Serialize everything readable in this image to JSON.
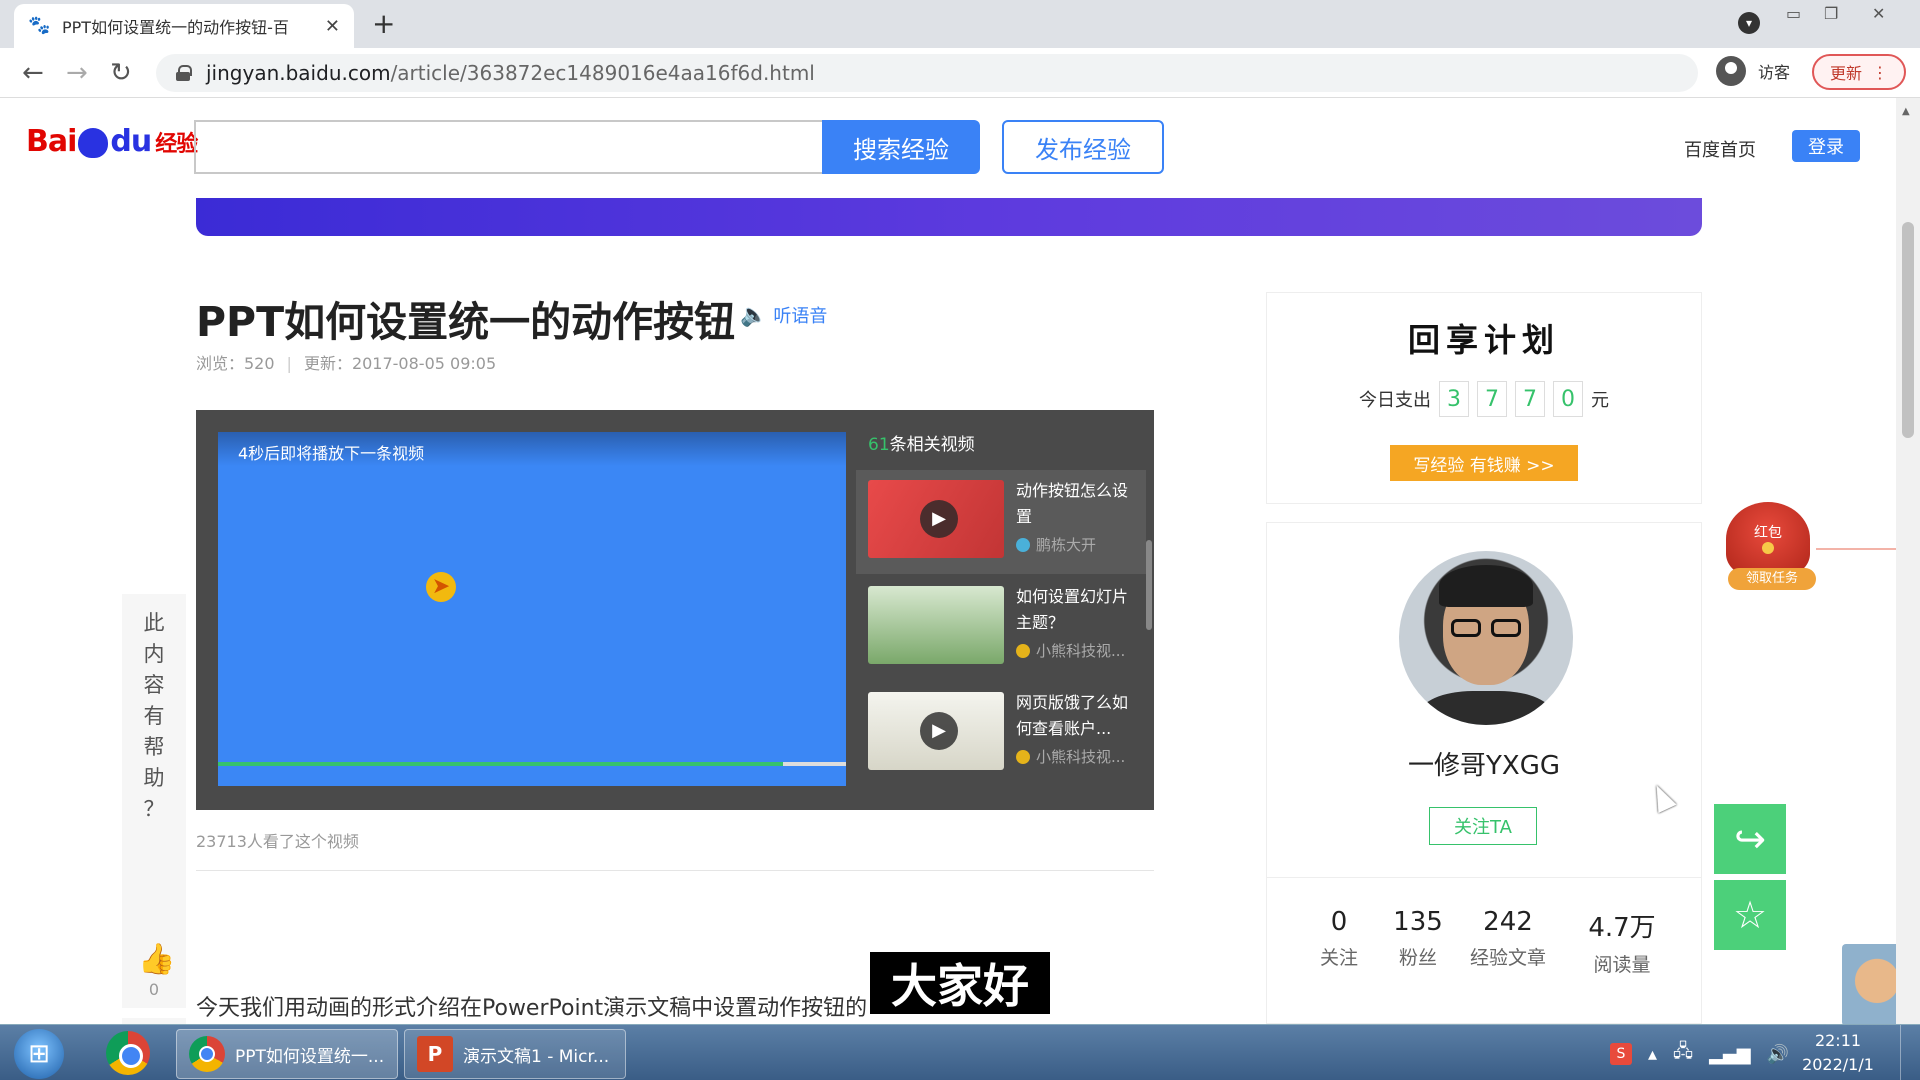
{
  "browser": {
    "tab_title": "PPT如何设置统一的动作按钮-百",
    "new_tab": "+",
    "url_host": "jingyan.baidu.com",
    "url_path": "/article/363872ec1489016e4aa16f6d.html",
    "visitor_label": "访客",
    "update_label": "更新"
  },
  "header": {
    "logo_bai": "Bai",
    "logo_du": "du",
    "logo_jingyan": "经验",
    "search_btn": "搜索经验",
    "publish_btn": "发布经验",
    "home_link": "百度首页",
    "login_btn": "登录"
  },
  "article": {
    "title": "PPT如何设置统一的动作按钮",
    "listen": "听语音",
    "views_label": "浏览：520",
    "updated_label": "更新：2017-08-05 09:05",
    "video_notice": "4秒后即将播放下一条视频",
    "progress_fraction": 0.9,
    "related_count": "61",
    "related_suffix": "条相关视频",
    "related": [
      {
        "title": "动作按钮怎么设置",
        "author": "鹏栋大开"
      },
      {
        "title": "如何设置幻灯片主题？",
        "author": "小熊科技视..."
      },
      {
        "title": "网页版饿了么如何查看账户...",
        "author": "小熊科技视..."
      }
    ],
    "watched_note": "23713人看了这个视频",
    "intro": "今天我们用动画的形式介绍在PowerPoint演示文稿中设置动作按钮的",
    "caption": "大家好"
  },
  "helpful": {
    "text": "此内容有帮助？",
    "count": "0"
  },
  "sidebar": {
    "plan_title": "回享计划",
    "spend_label": "今日支出",
    "spend_digits": [
      "3",
      "7",
      "7",
      "0"
    ],
    "spend_unit": "元",
    "write_btn": "写经验 有钱赚 >>",
    "username": "一修哥YXGG",
    "follow_btn": "关注TA",
    "stats": [
      {
        "num": "0",
        "label": "关注"
      },
      {
        "num": "135",
        "label": "粉丝"
      },
      {
        "num": "242",
        "label": "经验文章"
      },
      {
        "num": "4.7万",
        "label": "阅读量"
      }
    ],
    "redpacket_title": "红包",
    "redpacket_label": "领取任务"
  },
  "taskbar": {
    "chrome_task": "PPT如何设置统一...",
    "ppt_task": "演示文稿1 - Micr...",
    "time": "22:11",
    "date": "2022/1/1"
  },
  "colors": {
    "accent": "#3a82f6",
    "green": "#36c26b",
    "orange": "#f5a623",
    "baidu_red": "#e10602"
  }
}
